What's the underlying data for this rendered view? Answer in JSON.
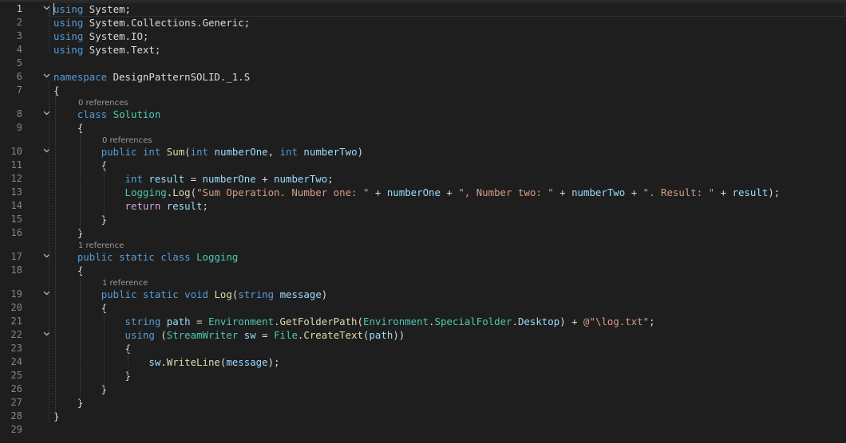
{
  "line_numbers": [
    "1",
    "2",
    "3",
    "4",
    "5",
    "6",
    "7",
    "8",
    "9",
    "10",
    "11",
    "12",
    "13",
    "14",
    "15",
    "16",
    "17",
    "18",
    "19",
    "20",
    "21",
    "22",
    "23",
    "24",
    "25",
    "26",
    "27",
    "28",
    "29"
  ],
  "code_lens": [
    "0 references",
    "0 references",
    "1 reference",
    "1 reference"
  ],
  "fold_lines": [
    1,
    6,
    8,
    10,
    17,
    19,
    22
  ],
  "lines": [
    [
      [
        "kw",
        "using"
      ],
      [
        "pl",
        " System;"
      ]
    ],
    [
      [
        "kw",
        "using"
      ],
      [
        "pl",
        " System.Collections.Generic;"
      ]
    ],
    [
      [
        "kw",
        "using"
      ],
      [
        "pl",
        " System.IO;"
      ]
    ],
    [
      [
        "kw",
        "using"
      ],
      [
        "pl",
        " System.Text;"
      ]
    ],
    [],
    [
      [
        "kw",
        "namespace"
      ],
      [
        "pl",
        " DesignPatternSOLID._1.S"
      ]
    ],
    [
      [
        "pl",
        "{"
      ]
    ],
    [
      [
        "pl",
        "    "
      ],
      [
        "kw",
        "class"
      ],
      [
        "pl",
        " "
      ],
      [
        "ty",
        "Solution"
      ]
    ],
    [
      [
        "pl",
        "    {"
      ]
    ],
    [
      [
        "pl",
        "        "
      ],
      [
        "kw",
        "public"
      ],
      [
        "pl",
        " "
      ],
      [
        "kw",
        "int"
      ],
      [
        "pl",
        " "
      ],
      [
        "mt",
        "Sum"
      ],
      [
        "pl",
        "("
      ],
      [
        "kw",
        "int"
      ],
      [
        "pl",
        " "
      ],
      [
        "id",
        "numberOne"
      ],
      [
        "pl",
        ", "
      ],
      [
        "kw",
        "int"
      ],
      [
        "pl",
        " "
      ],
      [
        "id",
        "numberTwo"
      ],
      [
        "pl",
        ")"
      ]
    ],
    [
      [
        "pl",
        "        {"
      ]
    ],
    [
      [
        "pl",
        "            "
      ],
      [
        "kw",
        "int"
      ],
      [
        "pl",
        " "
      ],
      [
        "id",
        "result"
      ],
      [
        "pl",
        " = "
      ],
      [
        "id",
        "numberOne"
      ],
      [
        "pl",
        " + "
      ],
      [
        "id",
        "numberTwo"
      ],
      [
        "pl",
        ";"
      ]
    ],
    [
      [
        "pl",
        "            "
      ],
      [
        "ty",
        "Logging"
      ],
      [
        "pl",
        "."
      ],
      [
        "mt",
        "Log"
      ],
      [
        "pl",
        "("
      ],
      [
        "str",
        "\"Sum Operation. Number one: \""
      ],
      [
        "pl",
        " + "
      ],
      [
        "id",
        "numberOne"
      ],
      [
        "pl",
        " + "
      ],
      [
        "str",
        "\", Number two: \""
      ],
      [
        "pl",
        " + "
      ],
      [
        "id",
        "numberTwo"
      ],
      [
        "pl",
        " + "
      ],
      [
        "str",
        "\". Result: \""
      ],
      [
        "pl",
        " + "
      ],
      [
        "id",
        "result"
      ],
      [
        "pl",
        ");"
      ]
    ],
    [
      [
        "pl",
        "            "
      ],
      [
        "ctl",
        "return"
      ],
      [
        "pl",
        " "
      ],
      [
        "id",
        "result"
      ],
      [
        "pl",
        ";"
      ]
    ],
    [
      [
        "pl",
        "        }"
      ]
    ],
    [
      [
        "pl",
        "    }"
      ]
    ],
    [
      [
        "pl",
        "    "
      ],
      [
        "kw",
        "public"
      ],
      [
        "pl",
        " "
      ],
      [
        "kw",
        "static"
      ],
      [
        "pl",
        " "
      ],
      [
        "kw",
        "class"
      ],
      [
        "pl",
        " "
      ],
      [
        "ty",
        "Logging"
      ]
    ],
    [
      [
        "pl",
        "    {"
      ]
    ],
    [
      [
        "pl",
        "        "
      ],
      [
        "kw",
        "public"
      ],
      [
        "pl",
        " "
      ],
      [
        "kw",
        "static"
      ],
      [
        "pl",
        " "
      ],
      [
        "kw",
        "void"
      ],
      [
        "pl",
        " "
      ],
      [
        "mt",
        "Log"
      ],
      [
        "pl",
        "("
      ],
      [
        "kw",
        "string"
      ],
      [
        "pl",
        " "
      ],
      [
        "id",
        "message"
      ],
      [
        "pl",
        ")"
      ]
    ],
    [
      [
        "pl",
        "        {"
      ]
    ],
    [
      [
        "pl",
        "            "
      ],
      [
        "kw",
        "string"
      ],
      [
        "pl",
        " "
      ],
      [
        "id",
        "path"
      ],
      [
        "pl",
        " = "
      ],
      [
        "ty",
        "Environment"
      ],
      [
        "pl",
        "."
      ],
      [
        "mt",
        "GetFolderPath"
      ],
      [
        "pl",
        "("
      ],
      [
        "ty",
        "Environment"
      ],
      [
        "pl",
        "."
      ],
      [
        "ty",
        "SpecialFolder"
      ],
      [
        "pl",
        "."
      ],
      [
        "id",
        "Desktop"
      ],
      [
        "pl",
        ") + "
      ],
      [
        "str",
        "@\"\\log.txt\""
      ],
      [
        "pl",
        ";"
      ]
    ],
    [
      [
        "pl",
        "            "
      ],
      [
        "kw",
        "using"
      ],
      [
        "pl",
        " ("
      ],
      [
        "ty",
        "StreamWriter"
      ],
      [
        "pl",
        " "
      ],
      [
        "id",
        "sw"
      ],
      [
        "pl",
        " = "
      ],
      [
        "ty",
        "File"
      ],
      [
        "pl",
        "."
      ],
      [
        "mt",
        "CreateText"
      ],
      [
        "pl",
        "("
      ],
      [
        "id",
        "path"
      ],
      [
        "pl",
        "))"
      ]
    ],
    [
      [
        "pl",
        "            {"
      ]
    ],
    [
      [
        "pl",
        "                "
      ],
      [
        "id",
        "sw"
      ],
      [
        "pl",
        "."
      ],
      [
        "mt",
        "WriteLine"
      ],
      [
        "pl",
        "("
      ],
      [
        "id",
        "message"
      ],
      [
        "pl",
        ");"
      ]
    ],
    [
      [
        "pl",
        "            }"
      ]
    ],
    [
      [
        "pl",
        "        }"
      ]
    ],
    [
      [
        "pl",
        "    }"
      ]
    ],
    [
      [
        "pl",
        "}"
      ]
    ],
    []
  ],
  "colors": {
    "background": "#1e1e1e",
    "keyword": "#569cd6",
    "type": "#4ec9b0",
    "string": "#d69d85",
    "identifier": "#9cdcfe",
    "method": "#dcdcaa",
    "control": "#d8a0df",
    "text": "#dcdcdc",
    "line_number": "#858585",
    "code_lens": "#999999"
  }
}
